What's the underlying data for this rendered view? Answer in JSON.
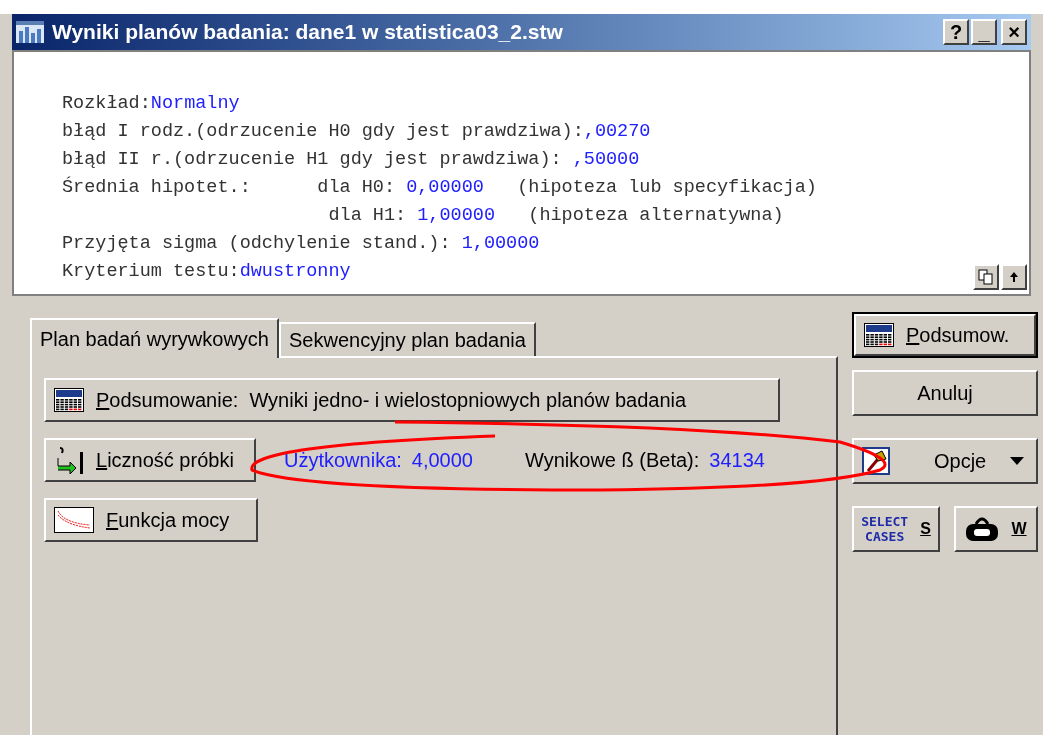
{
  "window": {
    "title": "Wyniki planów badania: dane1 w statistica03_2.stw",
    "controls": [
      "?",
      "_",
      "×"
    ]
  },
  "report": {
    "lines": [
      [
        {
          "kind": "label",
          "text": "Rozkład:"
        },
        {
          "kind": "value",
          "text": "Normalny"
        }
      ],
      [
        {
          "kind": "label",
          "text": "błąd I rodz.(odrzucenie H0 gdy jest prawdziwa):"
        },
        {
          "kind": "value",
          "text": ",00270"
        }
      ],
      [
        {
          "kind": "label",
          "text": "błąd II r.(odrzucenie H1 gdy jest prawdziwa): "
        },
        {
          "kind": "value",
          "text": ",50000"
        }
      ],
      [
        {
          "kind": "label",
          "text": "Średnia hipotet.:      dla H0: "
        },
        {
          "kind": "value",
          "text": "0,00000"
        },
        {
          "kind": "label",
          "text": "   (hipoteza lub specyfikacja)"
        }
      ],
      [
        {
          "kind": "label",
          "text": "                        dla H1: "
        },
        {
          "kind": "value",
          "text": "1,00000"
        },
        {
          "kind": "label",
          "text": "   (hipoteza alternatywna)"
        }
      ],
      [
        {
          "kind": "label",
          "text": "Przyjęta sigma (odchylenie stand.): "
        },
        {
          "kind": "value",
          "text": "1,00000"
        }
      ],
      [
        {
          "kind": "label",
          "text": "Kryterium testu:"
        },
        {
          "kind": "value",
          "text": "dwustronny"
        }
      ]
    ]
  },
  "tabs": [
    {
      "label": "Plan badań wyrywkowych",
      "selected": true
    },
    {
      "label": "Sekwencyjny plan badania",
      "selected": false
    }
  ],
  "panel": {
    "summary_button": {
      "mnemonic": "P",
      "rest": "odsumowanie:  Wyniki jedno- i wielostopniowych planów badania"
    },
    "sample_button": {
      "mnemonic": "L",
      "rest": "iczność próbki"
    },
    "user_label": "Użytkownika:",
    "user_value": "4,0000",
    "beta_label": "Wynikowe ß (Beta):",
    "beta_value": "34134",
    "power_button": {
      "mnemonic": "F",
      "rest": "unkcja mocy"
    }
  },
  "side": {
    "summary_button": {
      "mnemonic": "P",
      "rest": "odsumow."
    },
    "cancel_button": "Anuluj",
    "options_button": "Opcje",
    "select_cases": [
      "SELECT",
      "CASES"
    ],
    "select_key": "S",
    "weight_key": "W"
  }
}
